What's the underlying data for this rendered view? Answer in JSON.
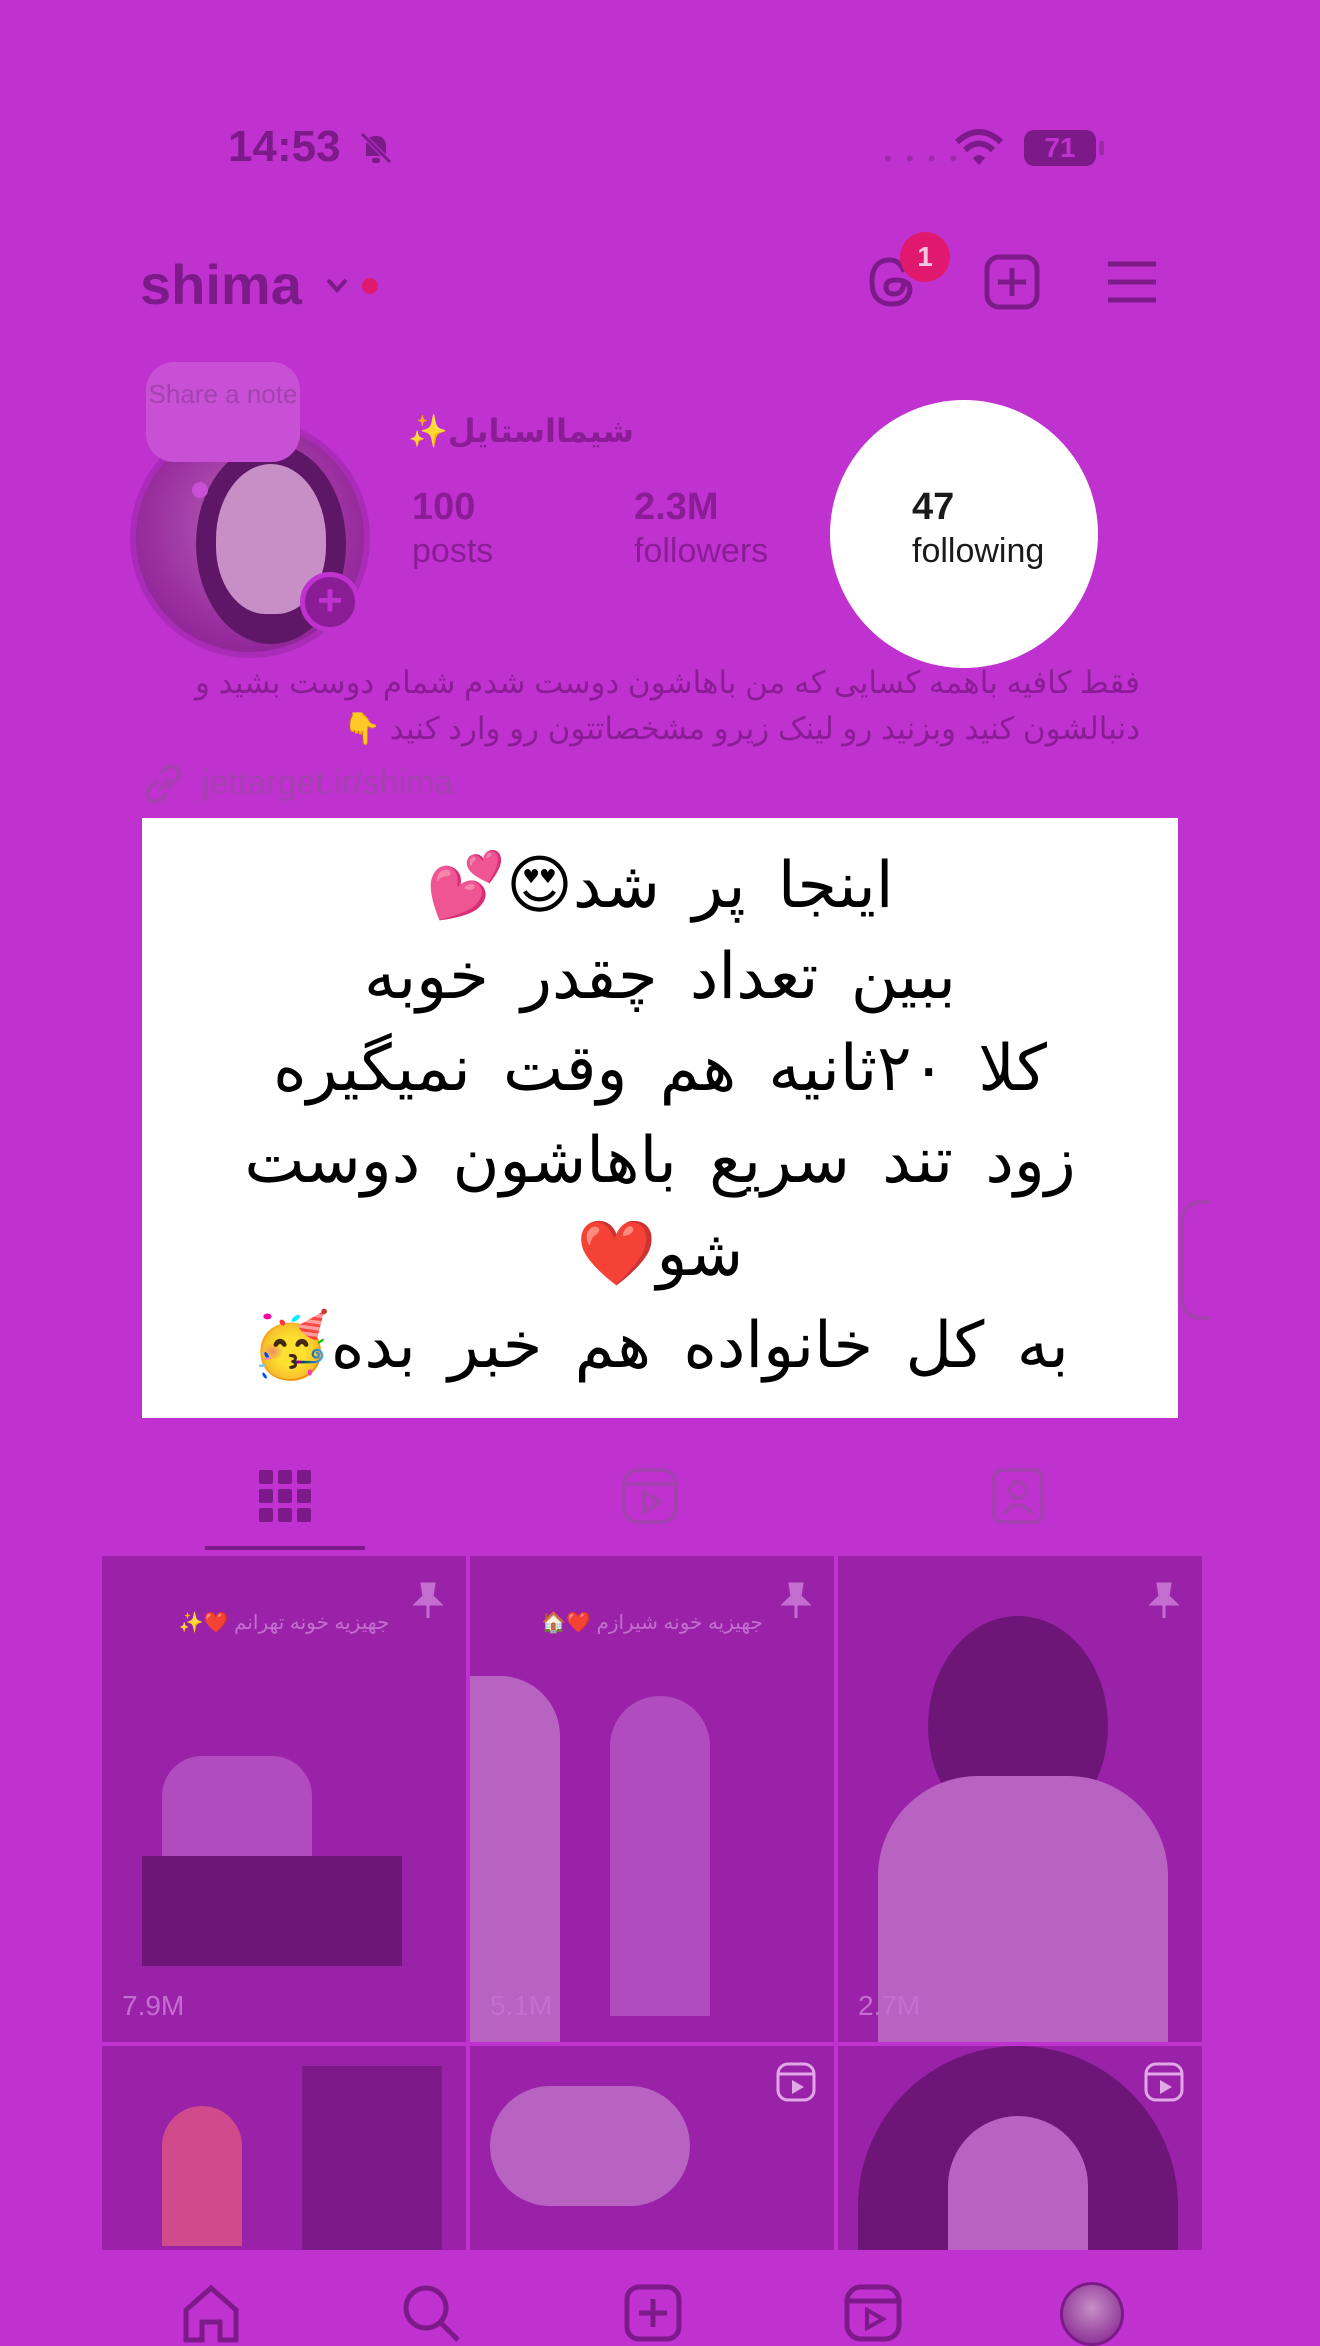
{
  "status_bar": {
    "time": "14:53",
    "battery": "71",
    "signal_dots": "• • • •"
  },
  "header": {
    "username": "shima",
    "threads_badge": "1",
    "icons": [
      "threads-icon",
      "new-post-icon",
      "menu-icon"
    ]
  },
  "profile": {
    "note_prompt": "Share a note",
    "display_name": "شیمااستایل✨",
    "stats": {
      "posts_count": "100",
      "posts_label": "posts",
      "followers_count": "2.3M",
      "followers_label": "followers",
      "following_count": "47",
      "following_label": "following"
    },
    "bio_line1": "فقط کافیه باهمه کسایی که من باهاشون دوست شدم شمام دوست بشید و",
    "bio_line2": "دنبالشون کنید وبزنید رو لینک زیرو مشخصاتتون رو وارد کنید 👇",
    "link": "jettarget.ir/shima"
  },
  "caption_overlay": {
    "line1": "اینجا پر شد😍💕",
    "line2": "ببین تعداد چقدر خوبه",
    "line3": "کلا ۲۰ثانیه هم وقت نمیگیره",
    "line4": "زود تند سریع باهاشون دوست",
    "line5": "شو❤️",
    "line6": "به کل خانواده هم خبر بده🥳"
  },
  "tabs": [
    "grid-tab",
    "reels-tab",
    "tagged-tab"
  ],
  "grid": {
    "posts": [
      {
        "caption": "جهیزیه خونه تهرانم ❤️✨",
        "views": "7.9M",
        "pinned": true
      },
      {
        "caption": "جهیزیه خونه شیرازم ❤️🏠",
        "views": "5.1M",
        "pinned": true
      },
      {
        "caption": "",
        "views": "2.7M",
        "pinned": true
      },
      {
        "caption": "",
        "views": "",
        "pinned": false
      },
      {
        "caption": "",
        "views": "",
        "pinned": false,
        "reel": true
      },
      {
        "caption": "",
        "views": "",
        "pinned": false,
        "reel": true
      }
    ]
  },
  "colors": {
    "overlay_magenta": "#c032cf",
    "badge_red": "#e0196e"
  }
}
